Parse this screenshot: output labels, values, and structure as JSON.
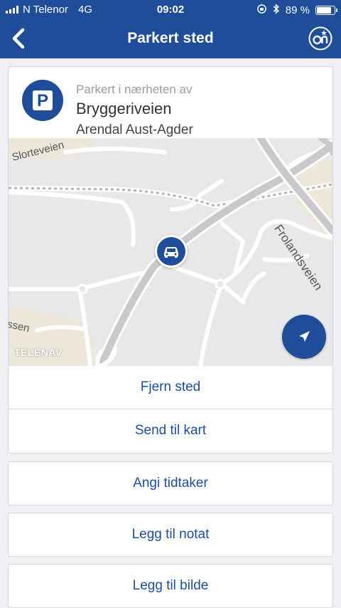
{
  "status_bar": {
    "carrier": "N Telenor",
    "network": "4G",
    "time": "09:02",
    "battery": "89 %",
    "battery_level": 0.89
  },
  "nav": {
    "title": "Parkert sted",
    "back_icon": "chevron-left-icon",
    "on_icon": "onstar-icon"
  },
  "location": {
    "label": "Parkert i nærheten av",
    "street": "Bryggeriveien",
    "city": "Arendal Aust-Agder",
    "parking_icon": "parking-icon"
  },
  "map": {
    "street_labels": [
      "Slorteveien",
      "Frolandsveien",
      "ssen"
    ],
    "attribution": "TELENAV",
    "marker_icon": "car-icon",
    "locate_icon": "location-arrow-icon"
  },
  "actions": {
    "remove": "Fjern sted",
    "send_to_map": "Send til kart",
    "set_timer": "Angi tidtaker",
    "add_note": "Legg til notat",
    "add_photo": "Legg til bilde"
  },
  "colors": {
    "brand": "#1f4d9a",
    "background": "#efeff4"
  }
}
